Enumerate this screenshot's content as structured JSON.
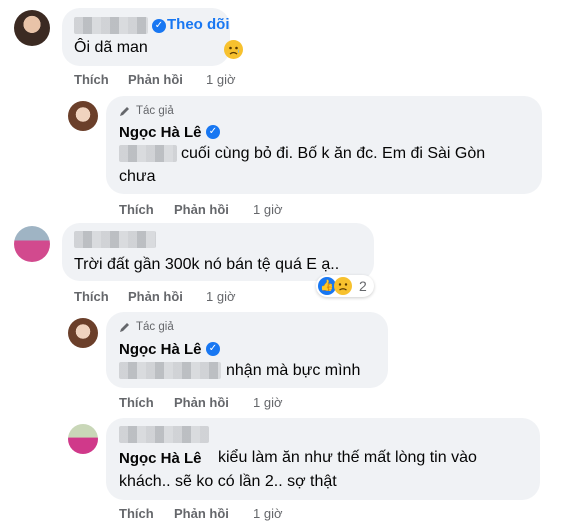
{
  "comments": [
    {
      "follow_label": "Theo dõi",
      "text": "Ôi dã man",
      "actions": {
        "like": "Thích",
        "reply": "Phản hồi",
        "time": "1 giờ"
      }
    },
    {
      "author_badge": "Tác giả",
      "author": "Ngọc Hà Lê",
      "text_line1": "cuối cùng bỏ đi. Bố k ăn đc. Em đi Sài Gòn",
      "text_line2": "chưa",
      "actions": {
        "like": "Thích",
        "reply": "Phản hồi",
        "time": "1 giờ"
      }
    },
    {
      "text": "Trời đất gần 300k nó bán tệ quá E ạ..",
      "reaction_count": "2",
      "actions": {
        "like": "Thích",
        "reply": "Phản hồi",
        "time": "1 giờ"
      }
    },
    {
      "author_badge": "Tác giả",
      "author": "Ngọc Hà Lê",
      "text": "nhận mà bực mình",
      "actions": {
        "like": "Thích",
        "reply": "Phản hồi",
        "time": "1 giờ"
      }
    },
    {
      "mention": "Ngọc Hà Lê",
      "text_line1": "kiểu làm ăn như thế mất lòng tin vào",
      "text_line2": "khách.. sẽ ko có lần 2.. sợ thật",
      "actions": {
        "like": "Thích",
        "reply": "Phản hồi",
        "time": "1 giờ"
      }
    }
  ],
  "colors": {
    "bubble": "#f0f2f5",
    "meta": "#65676b",
    "verified": "#1877f2",
    "follow": "#1877f2"
  },
  "icons": [
    "verified-badge-icon",
    "pen-icon",
    "sad-emoji-icon",
    "like-reaction-icon"
  ]
}
